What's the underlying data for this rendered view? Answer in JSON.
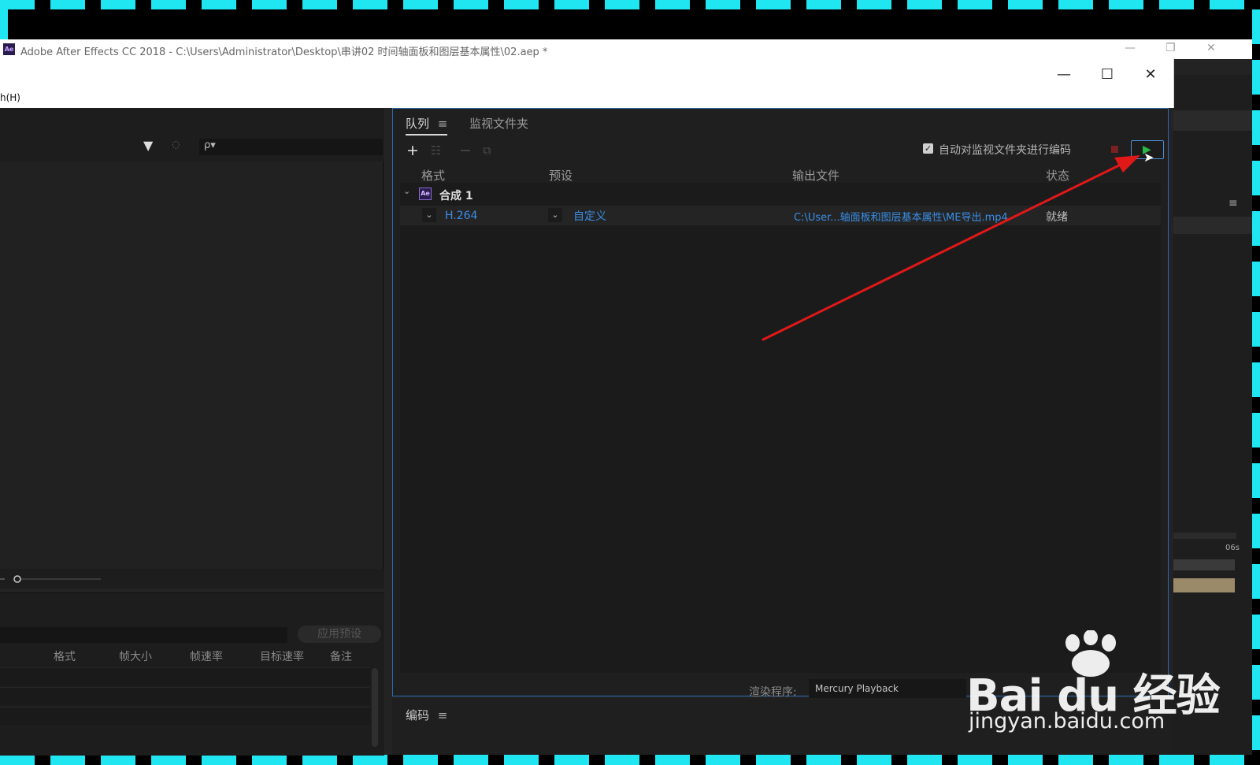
{
  "ae_window": {
    "title": "Adobe After Effects CC 2018 - C:\\Users\\Administrator\\Desktop\\串讲02  时间轴面板和图层基本属性\\02.aep *",
    "icon_text": "Ae",
    "controls": {
      "minimize": "—",
      "restore": "❐",
      "close": "✕"
    }
  },
  "ame_window": {
    "menu_fragment": "h(H)",
    "controls": {
      "minimize": "—",
      "maximize": "☐",
      "close": "✕"
    }
  },
  "left_panel": {
    "filter_icon": "filter-icon",
    "search_placeholder": "ρ▾"
  },
  "preset_panel": {
    "apply_preset_label": "应用预设",
    "columns": [
      "格式",
      "帧大小",
      "帧速率",
      "目标速率",
      "备注"
    ]
  },
  "queue": {
    "tabs": [
      {
        "label": "队列",
        "menu": "≡"
      },
      {
        "label": "监视文件夹"
      }
    ],
    "toolbar": {
      "add": "+",
      "settings": "☷",
      "remove": "−",
      "duplicate": "⧉"
    },
    "auto_encode": {
      "checked": true,
      "label": "自动对监视文件夹进行编码"
    },
    "columns": {
      "format": "格式",
      "preset": "预设",
      "output": "输出文件",
      "status": "状态"
    },
    "group": {
      "icon_text": "Ae",
      "name": "合成 1"
    },
    "items": [
      {
        "format": "H.264",
        "preset": "自定义",
        "output": "C:\\User...轴面板和图层基本属性\\ME导出.mp4",
        "status": "就绪"
      }
    ],
    "renderer_label": "渲染程序:",
    "renderer_value": "Mercury Playback"
  },
  "encode_panel": {
    "label": "编码",
    "menu": "≡"
  },
  "right_remnants": {
    "time_label": "06s",
    "menu": "≡"
  },
  "watermark": {
    "brand": "Bai du 经验",
    "url": "jingyan.baidu.com"
  },
  "colors": {
    "accent_blue": "#3a8ee6",
    "play_green": "#29b64a",
    "annotation_red": "#e01818",
    "frame_cyan": "#1fe6f0"
  }
}
